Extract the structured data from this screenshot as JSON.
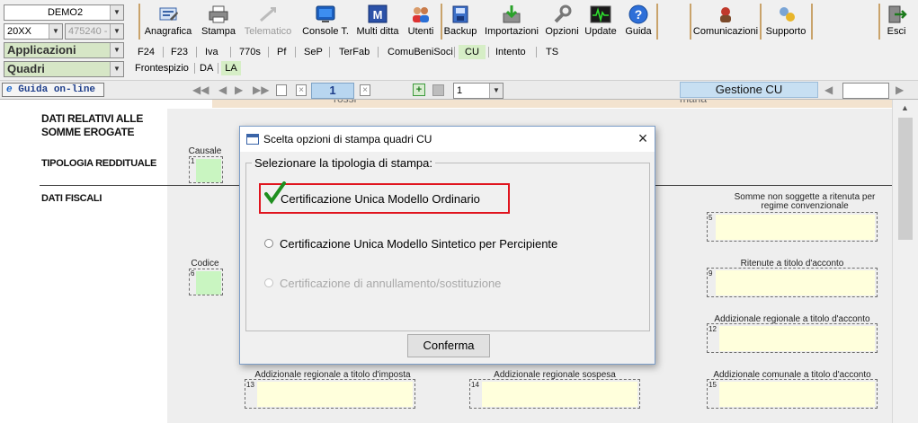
{
  "toolbar": {
    "company": "DEMO2",
    "year": "20XX",
    "code": "475240 -",
    "section1": "Applicazioni",
    "section2": "Quadri",
    "buttons": [
      {
        "label": "Anagrafica",
        "icon": "anagrafica-icon",
        "enabled": true
      },
      {
        "label": "Stampa",
        "icon": "printer-icon",
        "enabled": true
      },
      {
        "label": "Telematico",
        "icon": "telematico-icon",
        "enabled": false
      },
      {
        "label": "Console T.",
        "icon": "console-icon",
        "enabled": true
      },
      {
        "label": "Multi ditta",
        "icon": "multi-ditta-icon",
        "enabled": true
      },
      {
        "label": "Utenti",
        "icon": "users-icon",
        "enabled": true
      },
      {
        "label": "Backup",
        "icon": "backup-icon",
        "enabled": true
      },
      {
        "label": "Importazioni",
        "icon": "import-icon",
        "enabled": true
      },
      {
        "label": "Opzioni",
        "icon": "wrench-icon",
        "enabled": true
      },
      {
        "label": "Update",
        "icon": "update-icon",
        "enabled": true
      },
      {
        "label": "Guida",
        "icon": "help-icon",
        "enabled": true
      },
      {
        "label": "Comunicazioni",
        "icon": "comunicazioni-icon",
        "enabled": true
      },
      {
        "label": "Supporto",
        "icon": "supporto-icon",
        "enabled": true
      },
      {
        "label": "Esci",
        "icon": "exit-icon",
        "enabled": true
      }
    ]
  },
  "tabs_row1": [
    "F24",
    "F23",
    "Iva",
    "770s",
    "Pf",
    "SeP",
    "TerFab",
    "ComuBeniSoci",
    "CU",
    "Intento",
    "TS"
  ],
  "tabs_row1_selected": "CU",
  "tabs_row2": [
    "Frontespizio",
    "DA",
    "LA"
  ],
  "tabs_row2_selected": "LA",
  "navbar": {
    "guide": "Guida on-line",
    "page": "1",
    "select_value": "1",
    "gestione": "Gestione CU"
  },
  "form": {
    "header_partial_left": "rossi",
    "header_partial_right": "maria",
    "section_title": "DATI RELATIVI ALLE SOMME EROGATE",
    "tipologia": "TIPOLOGIA REDDITUALE",
    "dati_fiscali": "DATI FISCALI",
    "causale_label": "Causale",
    "causale_num": "1",
    "codice_label": "Codice",
    "codice_num": "6",
    "f5_label": "Somme non soggette a ritenuta per regime convenzionale",
    "f5_num": "5",
    "f9_label": "Ritenute a titolo d'acconto",
    "f9_num": "9",
    "f12_label": "Addizionale regionale a titolo d'acconto",
    "f12_num": "12",
    "f13_label": "Addizionale regionale a titolo d'imposta",
    "f13_num": "13",
    "f14_label": "Addizionale regionale sospesa",
    "f14_num": "14",
    "f15_label": "Addizionale comunale a titolo d'acconto",
    "f15_num": "15"
  },
  "dialog": {
    "title": "Scelta opzioni di stampa quadri CU",
    "group_label": "Selezionare la tipologia di stampa:",
    "options": [
      {
        "label": "Certificazione Unica Modello Ordinario",
        "selected": true,
        "enabled": true
      },
      {
        "label": "Certificazione Unica Modello Sintetico per Percipiente",
        "selected": false,
        "enabled": true
      },
      {
        "label": "Certificazione di annullamento/sostituzione",
        "selected": false,
        "enabled": false
      }
    ],
    "confirm": "Conferma",
    "close": "×"
  },
  "colors": {
    "highlight_border": "#e0141e",
    "check_green": "#1f8f1f",
    "field_yellow": "#ffffdc",
    "field_green": "#c9f5c1",
    "gestione_bg": "#c7dff2"
  }
}
